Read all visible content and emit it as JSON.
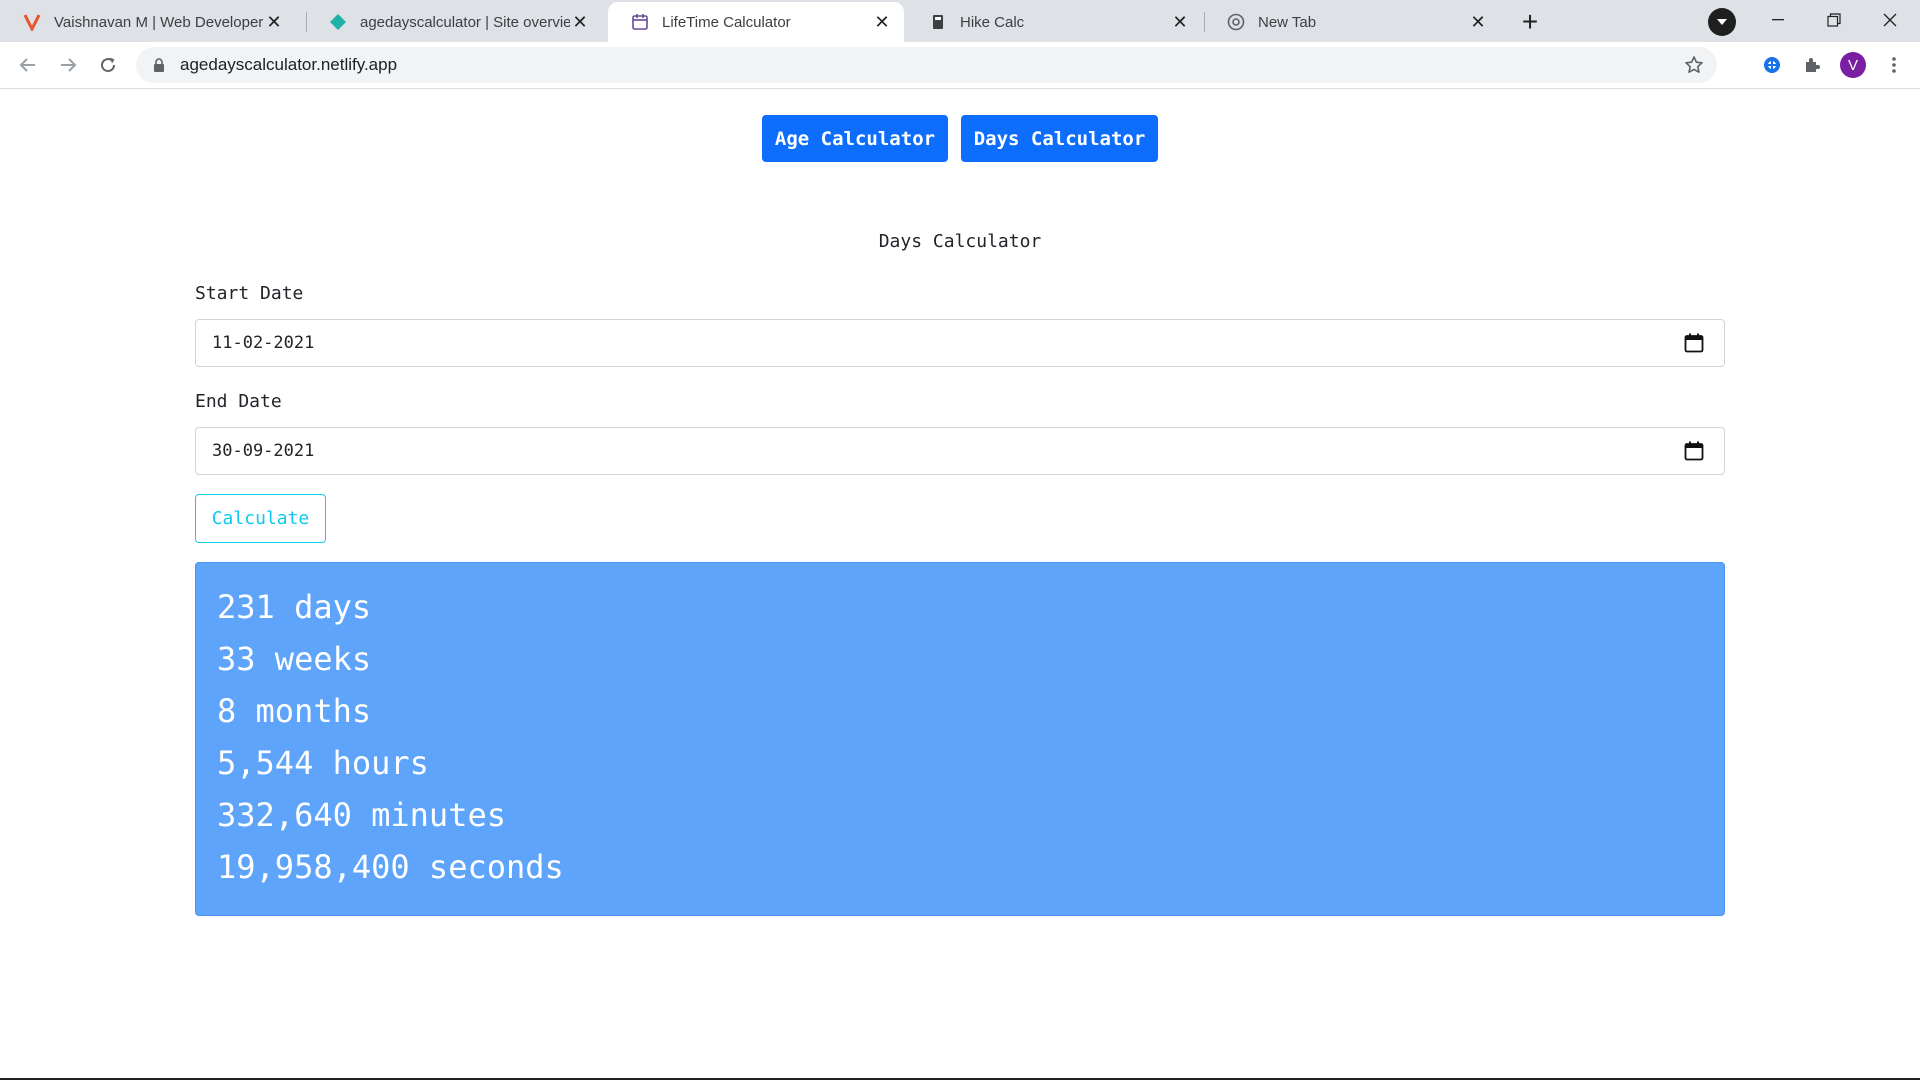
{
  "browser": {
    "tabs": [
      {
        "title": "Vaishnavan M | Web Developer",
        "active": false,
        "favicon": "v-logo-icon"
      },
      {
        "title": "agedayscalculator | Site overview",
        "active": false,
        "favicon": "netlify-icon"
      },
      {
        "title": "LifeTime Calculator",
        "active": true,
        "favicon": "calendar-icon"
      },
      {
        "title": "Hike Calc",
        "active": false,
        "favicon": "calc-icon"
      },
      {
        "title": "New Tab",
        "active": false,
        "favicon": "chrome-icon"
      }
    ],
    "address": "agedayscalculator.netlify.app",
    "profile_initial": "V",
    "accent_color": "#7b1fa2"
  },
  "page": {
    "nav": {
      "age_label": "Age Calculator",
      "days_label": "Days Calculator"
    },
    "heading": "Days Calculator",
    "start_date": {
      "label": "Start Date",
      "value": "11-02-2021"
    },
    "end_date": {
      "label": "End Date",
      "value": "30-09-2021"
    },
    "calculate_label": "Calculate",
    "results": [
      "231 days",
      "33 weeks",
      "8 months",
      "5,544 hours",
      "332,640 minutes",
      "19,958,400 seconds"
    ],
    "colors": {
      "primary": "#0d6efd",
      "info": "#0dcaf0",
      "result_bg": "#5ea4fa"
    }
  }
}
